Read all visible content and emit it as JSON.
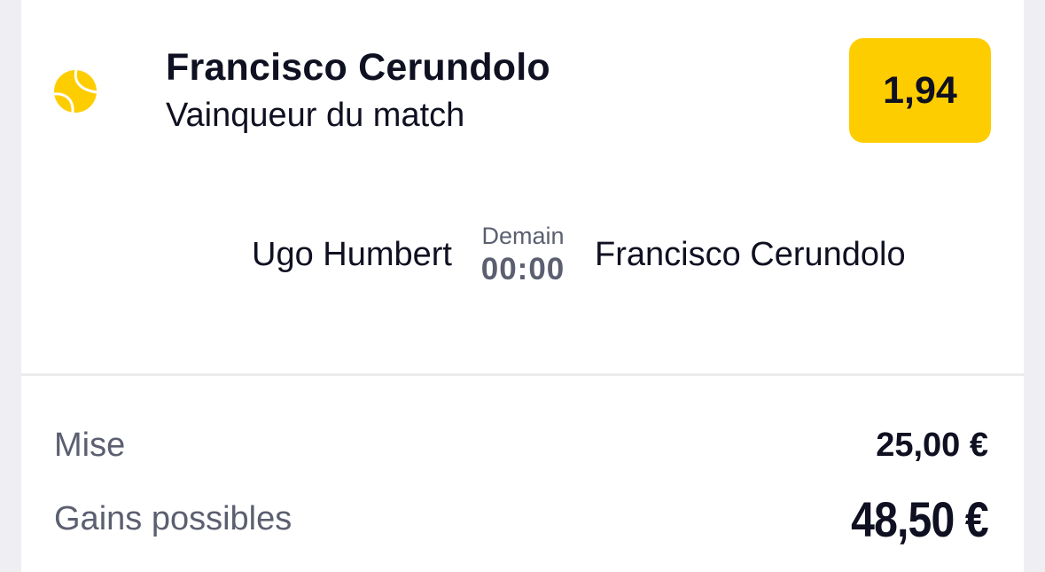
{
  "bet": {
    "selection": "Francisco Cerundolo",
    "market": "Vainqueur du match",
    "odds": "1,94",
    "sport_icon": "tennis-ball-icon"
  },
  "match": {
    "home": "Ugo Humbert",
    "away": "Francisco Cerundolo",
    "day": "Demain",
    "time": "00:00"
  },
  "summary": {
    "stake_label": "Mise",
    "stake_value": "25,00 €",
    "gains_label": "Gains possibles",
    "gains_value": "48,50 €"
  },
  "colors": {
    "odds_badge": "#fecd00",
    "icon": "#fecd00",
    "text_primary": "#0f1021",
    "text_secondary": "#5b5f70",
    "background": "#efeff3"
  }
}
